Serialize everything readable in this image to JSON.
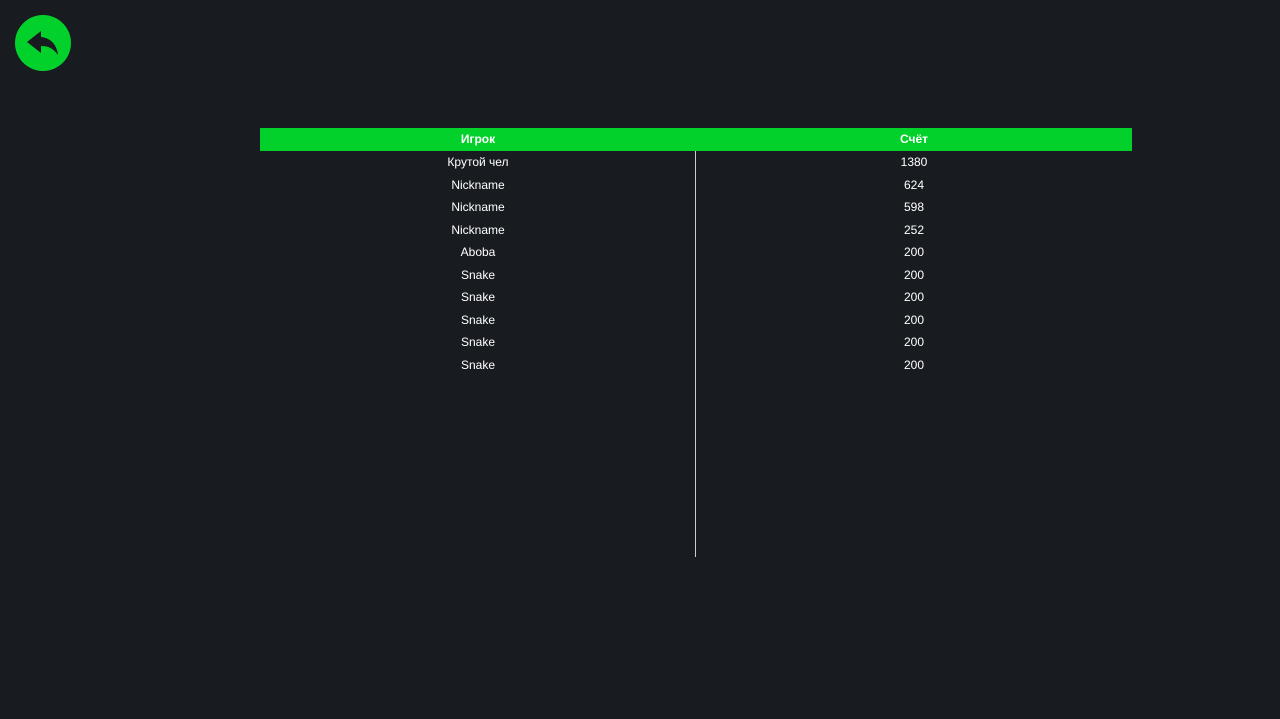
{
  "colors": {
    "background": "#181c21",
    "accent": "#03d12b",
    "text": "#ffffff",
    "divider": "#c9ccd1"
  },
  "back_button": {
    "icon": "back-arrow-icon"
  },
  "leaderboard": {
    "columns": [
      "Игрок",
      "Счёт"
    ],
    "rows": [
      {
        "player": "Крутой чел",
        "score": "1380"
      },
      {
        "player": "Nickname",
        "score": "624"
      },
      {
        "player": "Nickname",
        "score": "598"
      },
      {
        "player": "Nickname",
        "score": "252"
      },
      {
        "player": "Aboba",
        "score": "200"
      },
      {
        "player": "Snake",
        "score": "200"
      },
      {
        "player": "Snake",
        "score": "200"
      },
      {
        "player": "Snake",
        "score": "200"
      },
      {
        "player": "Snake",
        "score": "200"
      },
      {
        "player": "Snake",
        "score": "200"
      }
    ]
  }
}
